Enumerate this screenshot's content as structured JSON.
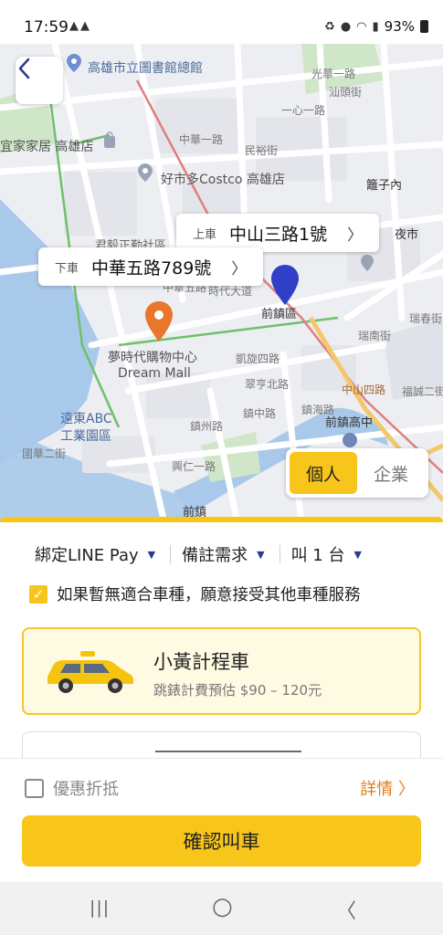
{
  "status_bar": {
    "time": "17:59",
    "left_icons": [
      "cat-icon",
      "cat-icon"
    ],
    "right_icons": [
      "recycle-icon",
      "location-icon",
      "wifi-icon",
      "signal-icon"
    ],
    "battery": "93%"
  },
  "map": {
    "labels": {
      "library": "高雄市立圖書館總館",
      "ikea": "宜家家居 高雄店",
      "costco": "好市多Costco 高雄店",
      "lizinei": "籬子內",
      "junshi": "君毅正勤社區",
      "night": "夜市",
      "qianzhen": "前鎮區",
      "ruinan": "瑞南街",
      "ruichun": "瑞春街",
      "dreammall_zh": "夢時代購物中心",
      "dreammall_en": "Dream Mall",
      "shidai": "時代大道",
      "kaixuan": "凱旋四路",
      "zhongshan": "中山四路",
      "cuiheng": "翠亨北路",
      "fuhua": "福誠二街",
      "zhenhai": "鎮海路",
      "qianzhen_hs": "前鎮高中",
      "far_east": "遠東ABC",
      "far_east2": "工業園區",
      "xingren": "興仁一路",
      "qianzhen2": "前鎮",
      "guohua": "國華二街",
      "shantou": "汕頭街",
      "guanghua": "光華一路",
      "yixin": "一心一路",
      "zhenzhou": "鎮州路",
      "zhenzhong": "鎮中路",
      "zhonghua": "中華五路",
      "minquan": "民裕街",
      "zhonghua1": "中華一路"
    },
    "pickup": {
      "tag": "上車",
      "address": "中山三路1號"
    },
    "dropoff": {
      "tag": "下車",
      "address": "中華五路789號"
    },
    "mode_toggle": {
      "personal": "個人",
      "business": "企業"
    }
  },
  "sheet": {
    "payment": "綁定LINE Pay",
    "notes": "備註需求",
    "count": "叫 1 台",
    "accept_other": "如果暫無適合車種，願意接受其他車種服務",
    "car_option": {
      "name": "小黃計程車",
      "price": "跳錶計費預估 $90 – 120元"
    },
    "discount_label": "優惠折抵",
    "details_label": "詳情 〉",
    "confirm_label": "確認叫車"
  },
  "nav_bar": {
    "recents": "|||",
    "home": "○",
    "back": "〈"
  }
}
